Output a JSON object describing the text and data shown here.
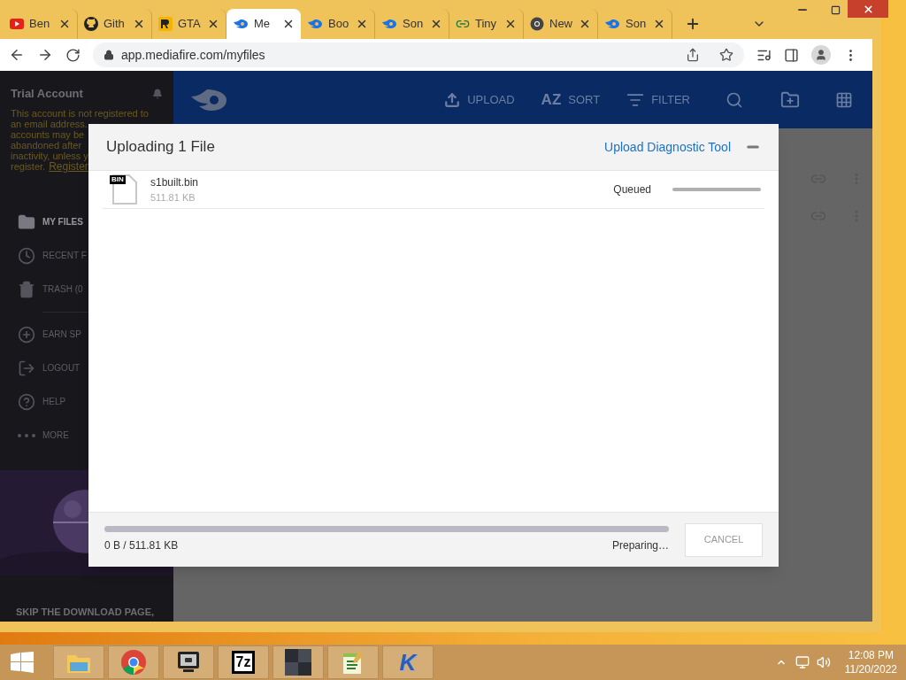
{
  "browser": {
    "tabs": [
      {
        "label": "Ben",
        "kind": "youtube",
        "selected": false
      },
      {
        "label": "Gith",
        "kind": "github",
        "selected": false
      },
      {
        "label": "GTA",
        "kind": "rockstar",
        "selected": false
      },
      {
        "label": "Me",
        "kind": "mediafire",
        "selected": true
      },
      {
        "label": "Boo",
        "kind": "mediafire",
        "selected": false
      },
      {
        "label": "Son",
        "kind": "mediafire",
        "selected": false
      },
      {
        "label": "Tiny",
        "kind": "link",
        "selected": false
      },
      {
        "label": "New",
        "kind": "chrome",
        "selected": false
      },
      {
        "label": "Son",
        "kind": "mediafire",
        "selected": false
      }
    ],
    "url": "app.mediafire.com/myfiles"
  },
  "sidebar": {
    "title": "Trial Account",
    "notice_lines": [
      "This account is not registered to",
      "an email address.",
      "accounts may be",
      "abandoned after",
      "inactivity, unless y"
    ],
    "notice_last": "register.",
    "notice_link": "Register",
    "items": [
      {
        "label": "MY FILES",
        "kind": "folder",
        "selected": true
      },
      {
        "label": "RECENT F",
        "kind": "clock",
        "selected": false
      },
      {
        "label": "TRASH (0",
        "kind": "trash",
        "selected": false
      },
      {
        "label": "EARN SP",
        "kind": "plus",
        "selected": false
      },
      {
        "label": "LOGOUT",
        "kind": "logout",
        "selected": false
      },
      {
        "label": "HELP",
        "kind": "help",
        "selected": false
      },
      {
        "label": "MORE",
        "kind": "more",
        "selected": false
      }
    ],
    "promo": "SKIP THE DOWNLOAD PAGE,"
  },
  "toolbar": {
    "actions": [
      {
        "label": "UPLOAD",
        "kind": "upload"
      },
      {
        "label": "SORT",
        "kind": "sort",
        "glyph": "AZ"
      },
      {
        "label": "FILTER",
        "kind": "filter"
      }
    ]
  },
  "dialog": {
    "title": "Uploading 1 File",
    "link": "Upload Diagnostic Tool",
    "files": [
      {
        "badge": "BIN",
        "name": "s1built.bin",
        "size": "511.81 KB",
        "status": "Queued",
        "level": 0
      }
    ],
    "total": "0 B / 511.81 KB",
    "level": 0,
    "status": "Preparing…",
    "cancel": "CANCEL"
  },
  "taskbar": {
    "apps": [
      {
        "kind": "explorer"
      },
      {
        "kind": "chrome"
      },
      {
        "kind": "monitor"
      },
      {
        "kind": "archive",
        "label": "7z"
      },
      {
        "kind": "dark"
      },
      {
        "kind": "notepad"
      },
      {
        "kind": "k",
        "label": "K"
      }
    ],
    "time": "12:08 PM",
    "date": "11/20/2022"
  }
}
